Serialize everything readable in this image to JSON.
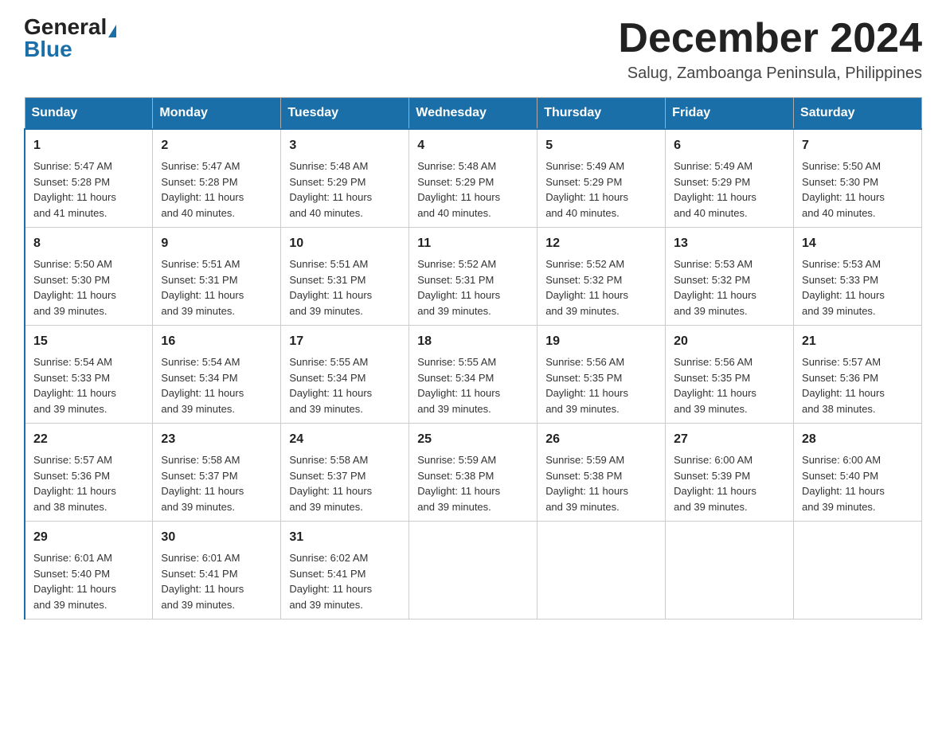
{
  "logo": {
    "general": "General",
    "blue": "Blue"
  },
  "header": {
    "month": "December 2024",
    "location": "Salug, Zamboanga Peninsula, Philippines"
  },
  "weekdays": [
    "Sunday",
    "Monday",
    "Tuesday",
    "Wednesday",
    "Thursday",
    "Friday",
    "Saturday"
  ],
  "weeks": [
    [
      {
        "day": "1",
        "sunrise": "5:47 AM",
        "sunset": "5:28 PM",
        "daylight": "11 hours and 41 minutes."
      },
      {
        "day": "2",
        "sunrise": "5:47 AM",
        "sunset": "5:28 PM",
        "daylight": "11 hours and 40 minutes."
      },
      {
        "day": "3",
        "sunrise": "5:48 AM",
        "sunset": "5:29 PM",
        "daylight": "11 hours and 40 minutes."
      },
      {
        "day": "4",
        "sunrise": "5:48 AM",
        "sunset": "5:29 PM",
        "daylight": "11 hours and 40 minutes."
      },
      {
        "day": "5",
        "sunrise": "5:49 AM",
        "sunset": "5:29 PM",
        "daylight": "11 hours and 40 minutes."
      },
      {
        "day": "6",
        "sunrise": "5:49 AM",
        "sunset": "5:29 PM",
        "daylight": "11 hours and 40 minutes."
      },
      {
        "day": "7",
        "sunrise": "5:50 AM",
        "sunset": "5:30 PM",
        "daylight": "11 hours and 40 minutes."
      }
    ],
    [
      {
        "day": "8",
        "sunrise": "5:50 AM",
        "sunset": "5:30 PM",
        "daylight": "11 hours and 39 minutes."
      },
      {
        "day": "9",
        "sunrise": "5:51 AM",
        "sunset": "5:31 PM",
        "daylight": "11 hours and 39 minutes."
      },
      {
        "day": "10",
        "sunrise": "5:51 AM",
        "sunset": "5:31 PM",
        "daylight": "11 hours and 39 minutes."
      },
      {
        "day": "11",
        "sunrise": "5:52 AM",
        "sunset": "5:31 PM",
        "daylight": "11 hours and 39 minutes."
      },
      {
        "day": "12",
        "sunrise": "5:52 AM",
        "sunset": "5:32 PM",
        "daylight": "11 hours and 39 minutes."
      },
      {
        "day": "13",
        "sunrise": "5:53 AM",
        "sunset": "5:32 PM",
        "daylight": "11 hours and 39 minutes."
      },
      {
        "day": "14",
        "sunrise": "5:53 AM",
        "sunset": "5:33 PM",
        "daylight": "11 hours and 39 minutes."
      }
    ],
    [
      {
        "day": "15",
        "sunrise": "5:54 AM",
        "sunset": "5:33 PM",
        "daylight": "11 hours and 39 minutes."
      },
      {
        "day": "16",
        "sunrise": "5:54 AM",
        "sunset": "5:34 PM",
        "daylight": "11 hours and 39 minutes."
      },
      {
        "day": "17",
        "sunrise": "5:55 AM",
        "sunset": "5:34 PM",
        "daylight": "11 hours and 39 minutes."
      },
      {
        "day": "18",
        "sunrise": "5:55 AM",
        "sunset": "5:34 PM",
        "daylight": "11 hours and 39 minutes."
      },
      {
        "day": "19",
        "sunrise": "5:56 AM",
        "sunset": "5:35 PM",
        "daylight": "11 hours and 39 minutes."
      },
      {
        "day": "20",
        "sunrise": "5:56 AM",
        "sunset": "5:35 PM",
        "daylight": "11 hours and 39 minutes."
      },
      {
        "day": "21",
        "sunrise": "5:57 AM",
        "sunset": "5:36 PM",
        "daylight": "11 hours and 38 minutes."
      }
    ],
    [
      {
        "day": "22",
        "sunrise": "5:57 AM",
        "sunset": "5:36 PM",
        "daylight": "11 hours and 38 minutes."
      },
      {
        "day": "23",
        "sunrise": "5:58 AM",
        "sunset": "5:37 PM",
        "daylight": "11 hours and 39 minutes."
      },
      {
        "day": "24",
        "sunrise": "5:58 AM",
        "sunset": "5:37 PM",
        "daylight": "11 hours and 39 minutes."
      },
      {
        "day": "25",
        "sunrise": "5:59 AM",
        "sunset": "5:38 PM",
        "daylight": "11 hours and 39 minutes."
      },
      {
        "day": "26",
        "sunrise": "5:59 AM",
        "sunset": "5:38 PM",
        "daylight": "11 hours and 39 minutes."
      },
      {
        "day": "27",
        "sunrise": "6:00 AM",
        "sunset": "5:39 PM",
        "daylight": "11 hours and 39 minutes."
      },
      {
        "day": "28",
        "sunrise": "6:00 AM",
        "sunset": "5:40 PM",
        "daylight": "11 hours and 39 minutes."
      }
    ],
    [
      {
        "day": "29",
        "sunrise": "6:01 AM",
        "sunset": "5:40 PM",
        "daylight": "11 hours and 39 minutes."
      },
      {
        "day": "30",
        "sunrise": "6:01 AM",
        "sunset": "5:41 PM",
        "daylight": "11 hours and 39 minutes."
      },
      {
        "day": "31",
        "sunrise": "6:02 AM",
        "sunset": "5:41 PM",
        "daylight": "11 hours and 39 minutes."
      },
      null,
      null,
      null,
      null
    ]
  ],
  "labels": {
    "sunrise": "Sunrise:",
    "sunset": "Sunset:",
    "daylight": "Daylight:"
  }
}
